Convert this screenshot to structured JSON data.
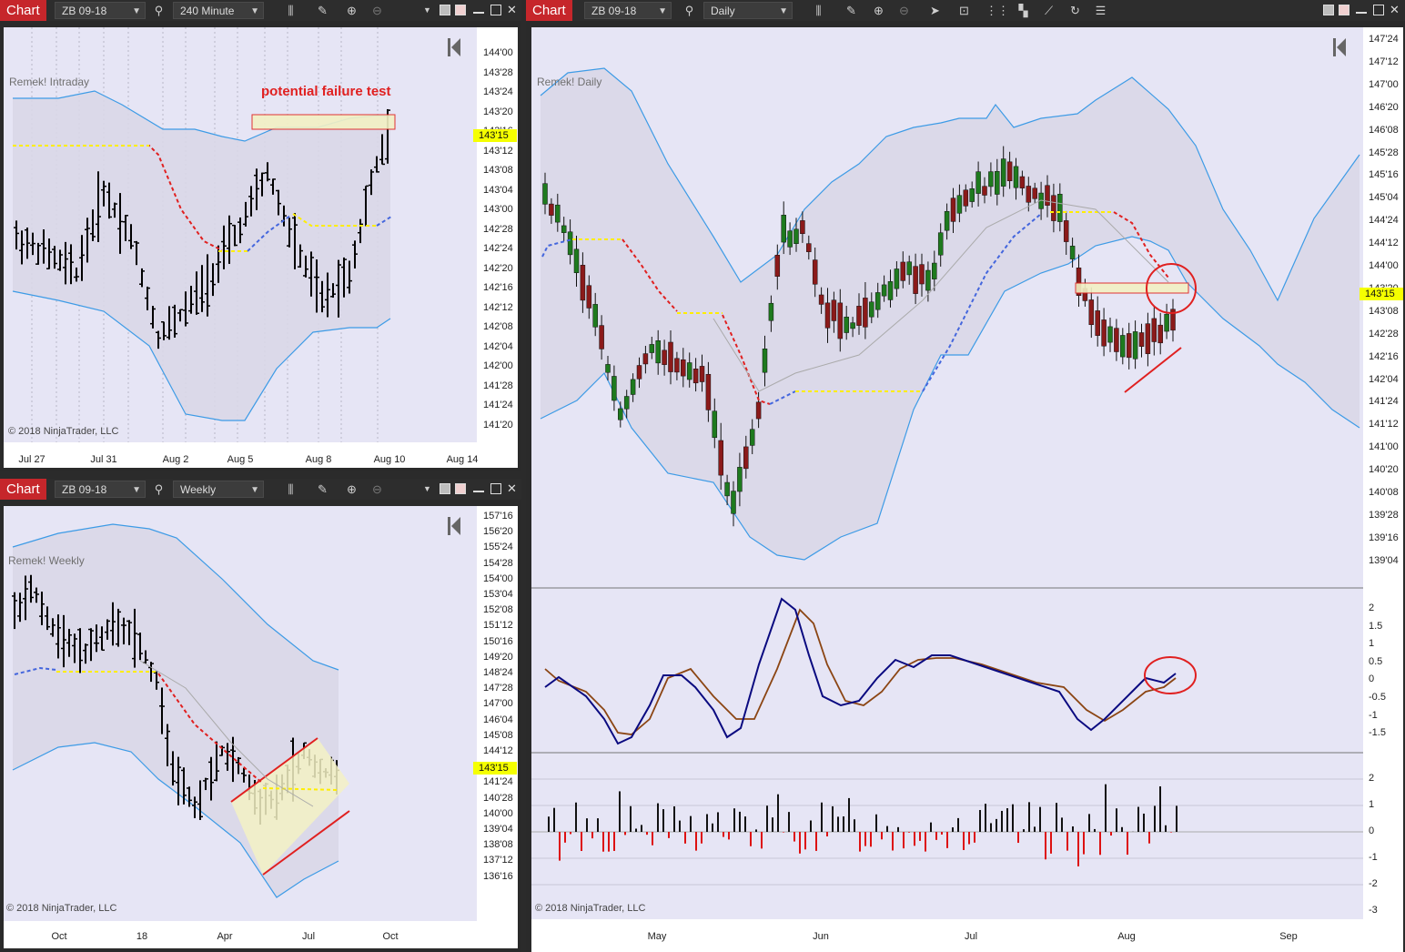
{
  "charts": [
    {
      "id": "intraday",
      "badge": "Chart",
      "instrument": "ZB 09-18",
      "interval": "240 Minute",
      "plot_label": "Remek! Intraday",
      "copyright": "© 2018 NinjaTrader, LLC",
      "annotation": "potential failure test",
      "price_tag": "143'15",
      "y_ticks": [
        "144'00",
        "143'28",
        "143'24",
        "143'20",
        "143'16",
        "143'12",
        "143'08",
        "143'04",
        "143'00",
        "142'28",
        "142'24",
        "142'20",
        "142'16",
        "142'12",
        "142'08",
        "142'04",
        "142'00",
        "141'28",
        "141'24",
        "141'20"
      ],
      "x_ticks": [
        "Jul 27",
        "Jul 31",
        "Aug 2",
        "Aug 5",
        "Aug 8",
        "Aug 10",
        "Aug 14"
      ]
    },
    {
      "id": "weekly",
      "badge": "Chart",
      "instrument": "ZB 09-18",
      "interval": "Weekly",
      "plot_label": "Remek! Weekly",
      "copyright": "© 2018 NinjaTrader, LLC",
      "price_tag": "143'15",
      "y_ticks": [
        "157'16",
        "156'20",
        "155'24",
        "154'28",
        "154'00",
        "153'04",
        "152'08",
        "151'12",
        "150'16",
        "149'20",
        "148'24",
        "147'28",
        "147'00",
        "146'04",
        "145'08",
        "144'12",
        "142'20",
        "141'24",
        "140'28",
        "140'00",
        "139'04",
        "138'08",
        "137'12",
        "136'16"
      ],
      "x_ticks": [
        "Oct",
        "18",
        "Apr",
        "Jul",
        "Oct"
      ]
    },
    {
      "id": "daily",
      "badge": "Chart",
      "instrument": "ZB 09-18",
      "interval": "Daily",
      "plot_label": "Remek! Daily",
      "copyright": "© 2018 NinjaTrader, LLC",
      "price_tag": "143'15",
      "y_ticks": [
        "147'24",
        "147'12",
        "147'00",
        "146'20",
        "146'08",
        "145'28",
        "145'16",
        "145'04",
        "144'24",
        "144'12",
        "144'00",
        "143'20",
        "143'08",
        "142'28",
        "142'16",
        "142'04",
        "141'24",
        "141'12",
        "141'00",
        "140'20",
        "140'08",
        "139'28",
        "139'16",
        "139'04"
      ],
      "osc_ticks": [
        "2",
        "1.5",
        "1",
        "0.5",
        "0",
        "-0.5",
        "-1",
        "-1.5"
      ],
      "hist_ticks": [
        "2",
        "1",
        "0",
        "-1",
        "-2",
        "-3"
      ],
      "x_ticks": [
        "May",
        "Jun",
        "Jul",
        "Aug",
        "Sep"
      ]
    }
  ],
  "colors": {
    "badge": "#c6262b",
    "canvas": "#e6e5f5",
    "band_fill": "#d4d3e3",
    "band_line": "#3d9be6",
    "trail_up": "#ffee00",
    "trail_down": "#e02020",
    "trail_support": "#4466dd",
    "osc_fast": "#0a0a80",
    "osc_slow": "#8b4513",
    "candle_up": "#1e7a1e",
    "candle_down": "#8b1a1a",
    "hist_pos": "#111111",
    "hist_neg": "#dd1111",
    "annot": "#e02020"
  }
}
